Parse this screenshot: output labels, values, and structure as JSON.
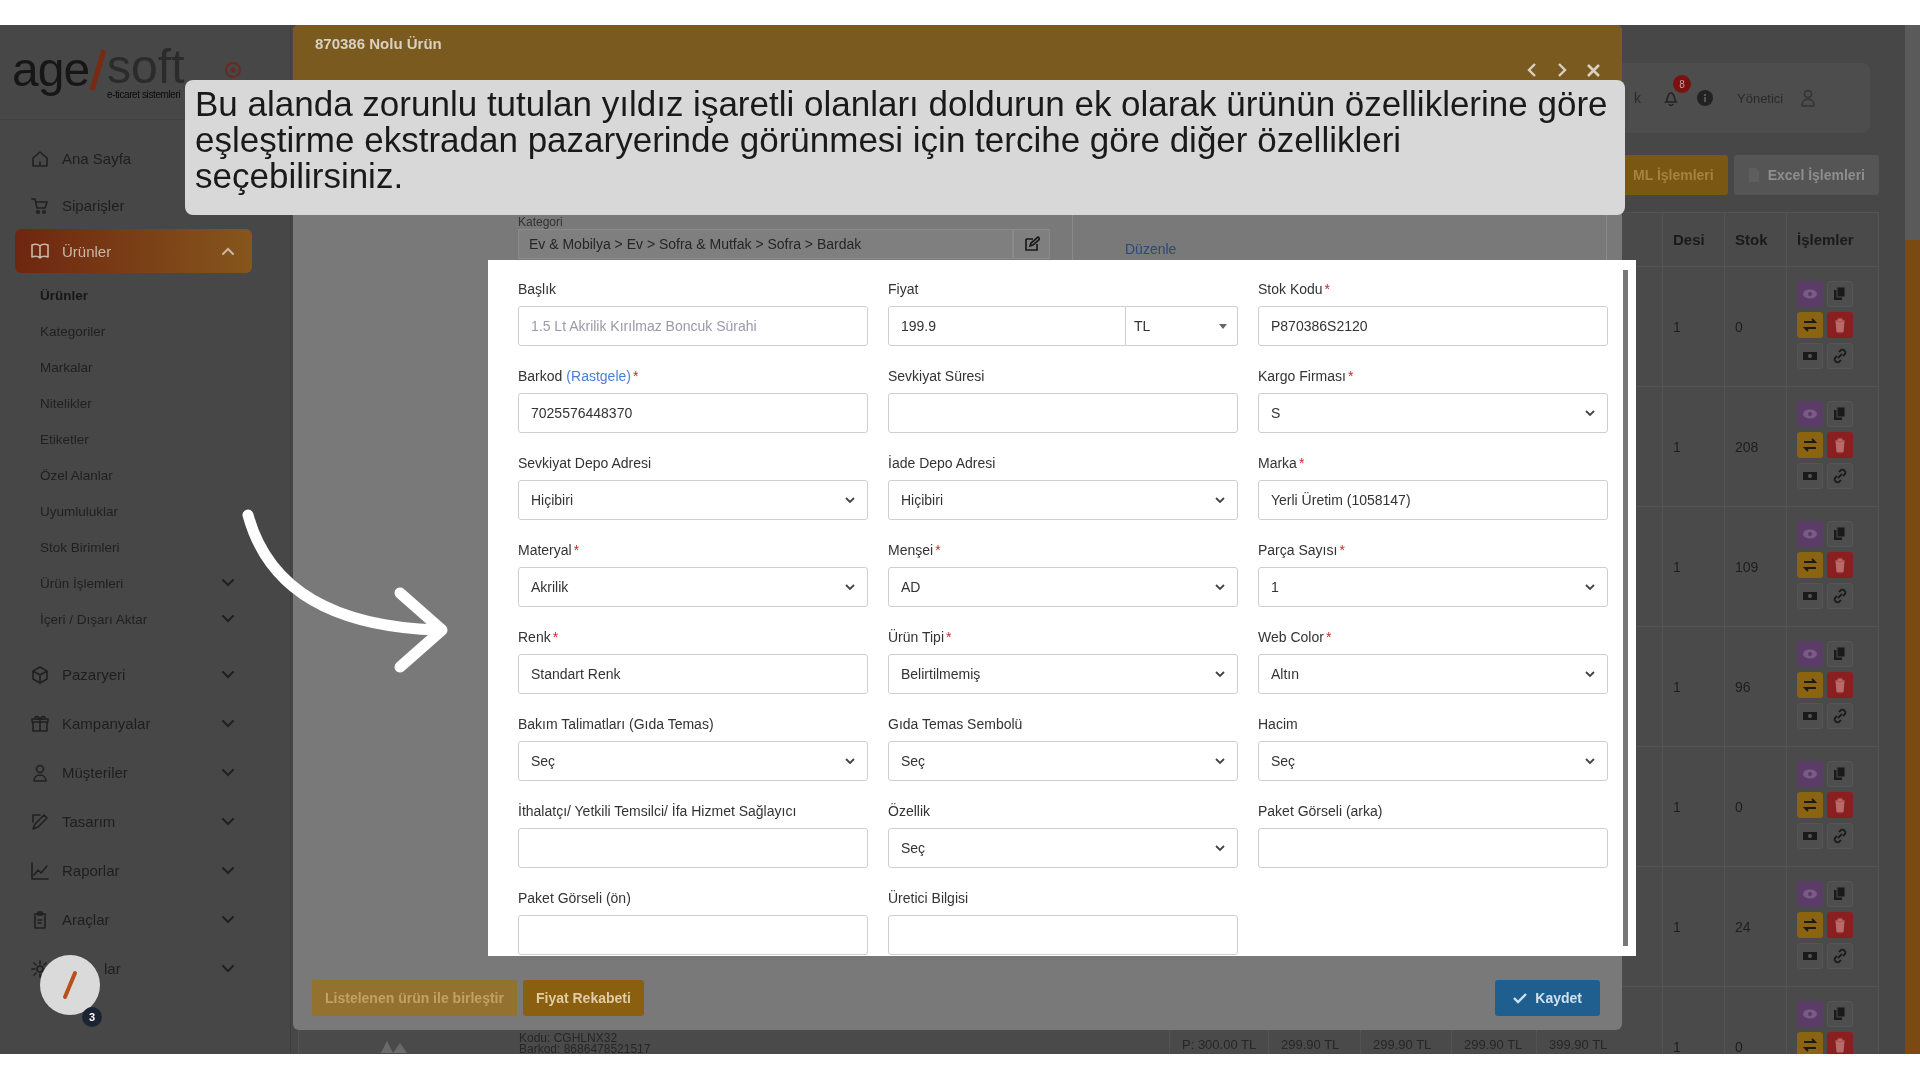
{
  "sidebar": {
    "logo": {
      "left": "age",
      "right": "soft",
      "tagline": "e-ticaret sistemleri"
    },
    "items": [
      {
        "label": "Ana Sayfa",
        "selected": false
      },
      {
        "label": "Siparişler",
        "selected": false
      },
      {
        "label": "Ürünler",
        "selected": true,
        "expanded": true,
        "children": [
          {
            "label": "Ürünler",
            "selected": true
          },
          {
            "label": "Kategoriler",
            "selected": false
          },
          {
            "label": "Markalar",
            "selected": false
          },
          {
            "label": "Nitelikler",
            "selected": false
          },
          {
            "label": "Etiketler",
            "selected": false
          },
          {
            "label": "Özel Alanlar",
            "selected": false
          },
          {
            "label": "Uyumluluklar",
            "selected": false
          },
          {
            "label": "Stok Birimleri",
            "selected": false
          },
          {
            "label": "Ürün İşlemleri",
            "selected": false,
            "expanded": false
          },
          {
            "label": "İçeri / Dışarı Aktar",
            "selected": false,
            "expanded": false
          }
        ]
      },
      {
        "label": "Pazaryeri",
        "selected": false,
        "expanded": false
      },
      {
        "label": "Kampanyalar",
        "selected": false,
        "expanded": false
      },
      {
        "label": "Müşteriler",
        "selected": false,
        "expanded": false
      },
      {
        "label": "Tasarım",
        "selected": false,
        "expanded": false
      },
      {
        "label": "Raporlar",
        "selected": false,
        "expanded": false
      },
      {
        "label": "Araçlar",
        "selected": false,
        "expanded": false
      },
      {
        "label": "lar",
        "selected": false,
        "expanded": false,
        "kind": "partial"
      }
    ]
  },
  "topbar": {
    "cut_text": "k",
    "notifications": "8",
    "user": "Yönetici"
  },
  "actions": [
    {
      "label": "ML İşlemleri",
      "kind": "primary"
    },
    {
      "label": "Excel İşlemleri",
      "kind": "excel"
    }
  ],
  "table": {
    "columns": [
      "Desi",
      "Stok",
      "İşlemler"
    ],
    "rows": [
      {
        "desi": "1",
        "stok": "0"
      },
      {
        "desi": "1",
        "stok": "208"
      },
      {
        "desi": "1",
        "stok": "109"
      },
      {
        "desi": "1",
        "stok": "96"
      },
      {
        "desi": "1",
        "stok": "0"
      },
      {
        "desi": "1",
        "stok": "24"
      },
      {
        "desi": "1",
        "stok": "0",
        "code": "Kodu: CGHLNX32",
        "barcode": "Barkod: 8686478521517",
        "prices": [
          "P: 300.00 TL",
          "299.90 TL",
          "299.90 TL",
          "299.90 TL",
          "399.90 TL"
        ]
      }
    ]
  },
  "modal": {
    "title": "870386 Nolu Ürün",
    "category_label": "Kategori",
    "category": "Ev & Mobilya > Ev > Sofra & Mutfak > Sofra > Bardak",
    "edit_link": "Düzenle",
    "buttons": [
      {
        "label": "Listelenen ürün ile birleştir",
        "kind": "merge"
      },
      {
        "label": "Fiyat Rekabeti",
        "kind": "compete"
      },
      {
        "label": "Kaydet",
        "kind": "save"
      }
    ]
  },
  "form": {
    "fields": [
      {
        "label": "Başlık",
        "kind": "text",
        "placeholder": "1.5 Lt Akrilik Kırılmaz Boncuk Sürahi"
      },
      {
        "label": "Fiyat",
        "kind": "price",
        "value": "199.9",
        "currency": "TL"
      },
      {
        "label": "Stok Kodu",
        "required_mark": "*",
        "kind": "text",
        "value": "P870386S2120"
      },
      {
        "label": "Barkod",
        "link": "(Rastgele)",
        "required_mark": "*",
        "kind": "text",
        "value": "7025576448370"
      },
      {
        "label": "Sevkiyat Süresi",
        "kind": "text"
      },
      {
        "label": "Kargo Firması",
        "required_mark": "*",
        "kind": "select",
        "value": "S"
      },
      {
        "label": "Sevkiyat Depo Adresi",
        "kind": "select",
        "value": "Hiçibiri"
      },
      {
        "label": "İade Depo Adresi",
        "kind": "select",
        "value": "Hiçibiri"
      },
      {
        "label": "Marka",
        "required_mark": "*",
        "kind": "text",
        "value": "Yerli Üretim (1058147)"
      },
      {
        "label": "Materyal",
        "required_mark": "*",
        "kind": "select",
        "value": "Akrilik"
      },
      {
        "label": "Menşei",
        "required_mark": "*",
        "kind": "select",
        "value": "AD"
      },
      {
        "label": "Parça Sayısı",
        "required_mark": "*",
        "kind": "select",
        "value": "1"
      },
      {
        "label": "Renk",
        "required_mark": "*",
        "kind": "text",
        "value": "Standart Renk"
      },
      {
        "label": "Ürün Tipi",
        "required_mark": "*",
        "kind": "select",
        "value": "Belirtilmemiş"
      },
      {
        "label": "Web Color",
        "required_mark": "*",
        "kind": "select",
        "value": "Altın"
      },
      {
        "label": "Bakım Talimatları (Gıda Temas)",
        "kind": "select",
        "value": "Seç"
      },
      {
        "label": "Gıda Temas Sembolü",
        "kind": "select",
        "value": "Seç"
      },
      {
        "label": "Hacim",
        "kind": "select",
        "value": "Seç"
      },
      {
        "label": "İthalatçı/ Yetkili Temsilci/ İfa Hizmet Sağlayıcı",
        "kind": "text"
      },
      {
        "label": "Özellik",
        "kind": "select",
        "value": "Seç"
      },
      {
        "label": "Paket Görseli (arka)",
        "kind": "text"
      },
      {
        "label": "Paket Görseli (ön)",
        "kind": "text"
      },
      {
        "label": "Üretici Bilgisi",
        "kind": "text"
      }
    ]
  },
  "tooltip": {
    "text": "Bu alanda zorunlu tutulan yıldız işaretli olanları doldurun ek olarak ürünün özelliklerine göre eşleştirme ekstradan pazaryerinde görünmesi için tercihe göre diğer özellikleri seçebilirsiniz."
  },
  "avatar": {
    "badge": "3"
  }
}
